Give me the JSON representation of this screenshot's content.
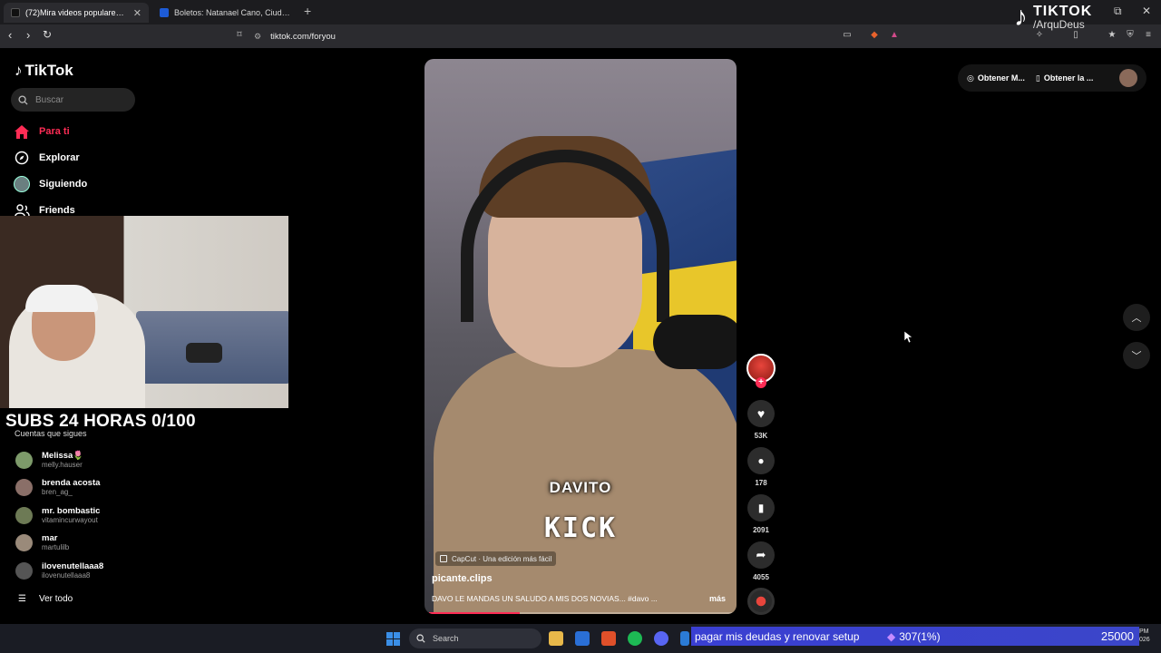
{
  "browser": {
    "tabs": [
      {
        "title": "(72)Mira videos populares se",
        "active": true
      },
      {
        "title": "Boletos: Natanael Cano, Ciudad de M",
        "active": false
      }
    ],
    "url": "tiktok.com/foryou"
  },
  "overlay_logo": {
    "brand": "TIKTOK",
    "handle": "/ArquDeus"
  },
  "sidebar": {
    "logo": "TikTok",
    "search_placeholder": "Buscar",
    "nav": [
      {
        "label": "Para ti",
        "icon": "home-icon",
        "active": true
      },
      {
        "label": "Explorar",
        "icon": "compass-icon",
        "active": false
      },
      {
        "label": "Siguiendo",
        "icon": "following-avatar-icon",
        "active": false
      },
      {
        "label": "Friends",
        "icon": "friends-icon",
        "active": false
      }
    ],
    "following_header": "Cuentas que sigues",
    "accounts": [
      {
        "name": "Melissa🌷",
        "handle": "melly.hauser"
      },
      {
        "name": "brenda acosta",
        "handle": "bren_ag_"
      },
      {
        "name": "mr. bombastic",
        "handle": "vitamincurwayout"
      },
      {
        "name": "mar",
        "handle": "martulilb"
      },
      {
        "name": "ilovenutellaaa8",
        "handle": "ilovenutellaaa8"
      }
    ],
    "see_all": "Ver todo"
  },
  "stream_overlay": {
    "subs_goal": "SUBS 24 HORAS 0/100"
  },
  "video": {
    "caption_top": "DAVITO",
    "caption_bottom": "KICK",
    "capcut": "CapCut · Una edición más fácil",
    "author": "picante.clips",
    "description": "DAVO LE MANDAS UN SALUDO A MIS DOS NOVIAS... #davo ...",
    "more": "más",
    "progress": 0.3
  },
  "actions": {
    "likes": "53K",
    "comments": "178",
    "saves": "2091",
    "shares": "4055"
  },
  "topbar": {
    "get_coins": "Obtener M...",
    "get_app": "Obtener la ..."
  },
  "taskbar": {
    "search": "Search",
    "goal_text": "pagar mis deudas y renovar setup",
    "goal_progress": "307(1%)",
    "goal_target": "25000",
    "clock_top": "PM",
    "clock_bottom": "026"
  },
  "colors": {
    "accent": "#fe2c55",
    "goal_bar": "#3a3fd2"
  }
}
